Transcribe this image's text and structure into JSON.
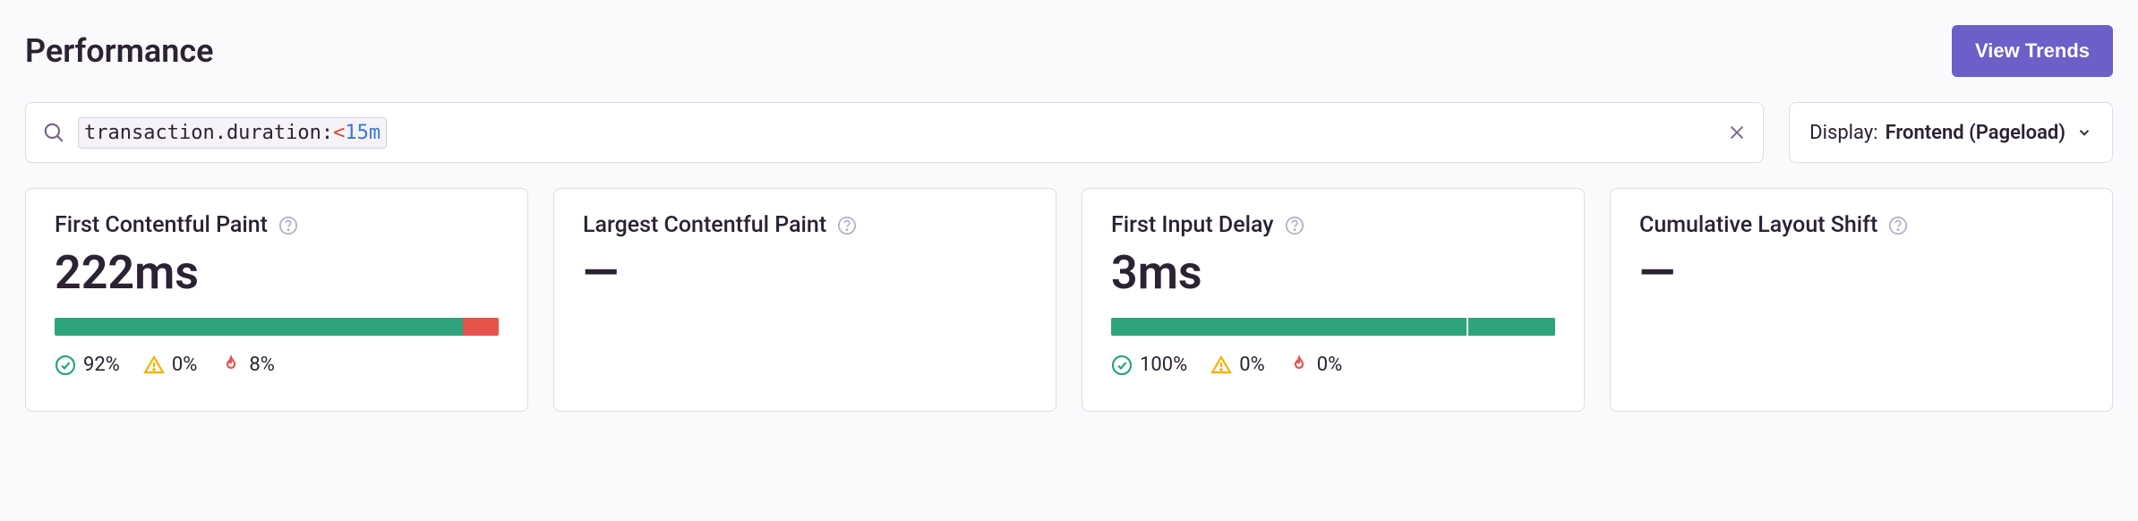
{
  "header": {
    "title": "Performance",
    "view_trends": "View Trends"
  },
  "search": {
    "token_key": "transaction.duration:",
    "token_op": "<",
    "token_val": "15m"
  },
  "display": {
    "label": "Display:",
    "value": "Frontend (Pageload)"
  },
  "cards": {
    "fcp": {
      "title": "First Contentful Paint",
      "value": "222ms",
      "good_pct": 92,
      "meh_pct": 0,
      "bad_pct": 8,
      "good_label": "92%",
      "meh_label": "0%",
      "bad_label": "8%"
    },
    "lcp": {
      "title": "Largest Contentful Paint",
      "value": "—"
    },
    "fid": {
      "title": "First Input Delay",
      "value": "3ms",
      "good_pct": 100,
      "meh_pct": 0,
      "bad_pct": 0,
      "marker_pct": 80,
      "good_label": "100%",
      "meh_label": "0%",
      "bad_label": "0%"
    },
    "cls": {
      "title": "Cumulative Layout Shift",
      "value": "—"
    }
  }
}
